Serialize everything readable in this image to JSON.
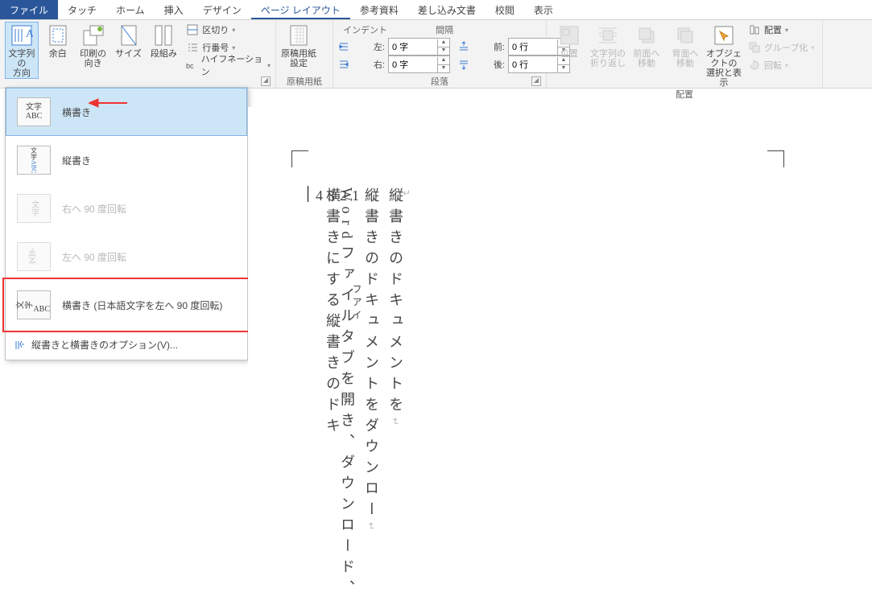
{
  "tabs": {
    "file": "ファイル",
    "list": [
      "タッチ",
      "ホーム",
      "挿入",
      "デザイン",
      "ページ レイアウト",
      "参考資料",
      "差し込み文書",
      "校閲",
      "表示"
    ],
    "active": 4
  },
  "ribbon": {
    "pageSetup": {
      "textDir": "文字列の\n方向",
      "margins": "余白",
      "orientation": "印刷の\n向き",
      "size": "サイズ",
      "columns": "段組み",
      "breaks": "区切り",
      "lineNumbers": "行番号",
      "hyphenation": "ハイフネーション",
      "groupLabel": ""
    },
    "manuscript": {
      "btn": "原稿用紙\n設定",
      "groupLabel": "原稿用紙"
    },
    "paragraph": {
      "indentTitle": "インデント",
      "spacingTitle": "間隔",
      "left": "左:",
      "right": "右:",
      "before": "前:",
      "after": "後:",
      "leftVal": "0 字",
      "rightVal": "0 字",
      "beforeVal": "0 行",
      "afterVal": "0 行",
      "groupLabel": "段落"
    },
    "arrange": {
      "position": "位置",
      "wrap": "文字列の\n折り返し",
      "forward": "前面へ\n移動",
      "backward": "背面へ\n移動",
      "selection": "オブジェクトの\n選択と表示",
      "align": "配置",
      "group": "グループ化",
      "rotate": "回転",
      "groupLabel": "配置"
    }
  },
  "dropdown": {
    "items": [
      {
        "thumb": "文字\nABC",
        "label": "横書き",
        "sel": true,
        "dis": false
      },
      {
        "thumb": "縦",
        "label": "縦書き",
        "sel": false,
        "dis": false
      },
      {
        "thumb": "R",
        "label": "右へ 90 度回転",
        "sel": false,
        "dis": true
      },
      {
        "thumb": "L",
        "label": "左へ 90 度回転",
        "sel": false,
        "dis": true
      },
      {
        "thumb": "90",
        "label": "横書き (日本語文字を左へ 90 度回転)",
        "sel": false,
        "dis": false,
        "boxed": true
      }
    ],
    "options": "縦書きと横書きのオプション(V)..."
  },
  "document": {
    "columns": [
      "縦書きのドキュメントを",
      "縦書きのドキュメントをダウンロー",
      "Wordファイルタブを開き、ダウンロード、",
      "フアイ",
      "横書きにする縦書きのドキ",
      "4321"
    ]
  }
}
